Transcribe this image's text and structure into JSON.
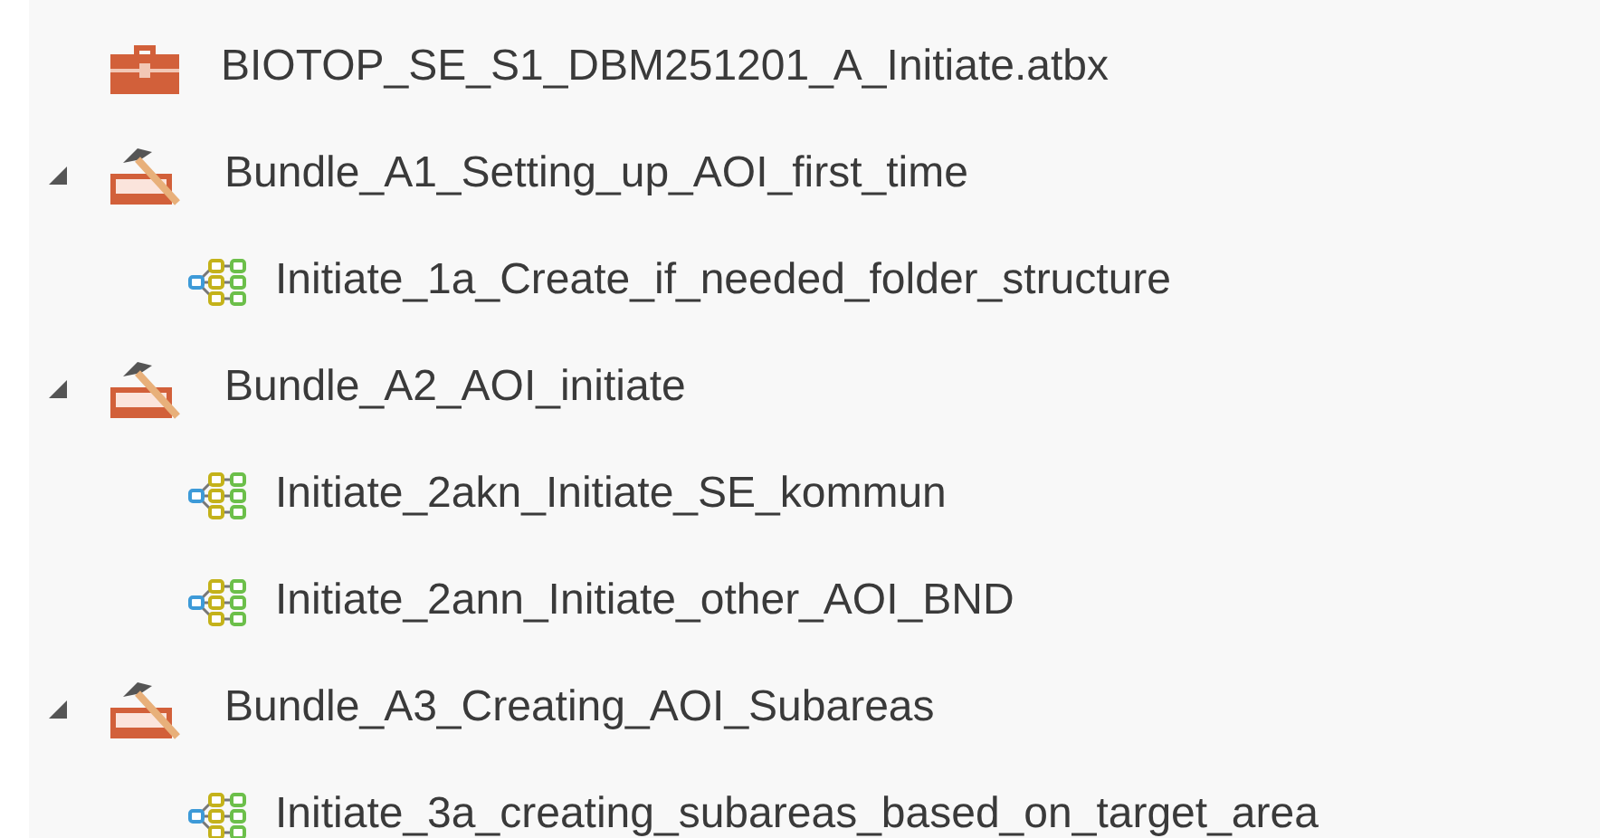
{
  "tree": {
    "kind": "toolbox",
    "label": "BIOTOP_SE_S1_DBM251201_A_Initiate.atbx",
    "children": [
      {
        "kind": "toolset",
        "label": "Bundle_A1_Setting_up_AOI_first_time",
        "expanded": true,
        "children": [
          {
            "kind": "model",
            "label": "Initiate_1a_Create_if_needed_folder_structure"
          }
        ]
      },
      {
        "kind": "toolset",
        "label": "Bundle_A2_AOI_initiate",
        "expanded": true,
        "children": [
          {
            "kind": "model",
            "label": "Initiate_2akn_Initiate_SE_kommun"
          },
          {
            "kind": "model",
            "label": "Initiate_2ann_Initiate_other_AOI_BND"
          }
        ]
      },
      {
        "kind": "toolset",
        "label": "Bundle_A3_Creating_AOI_Subareas",
        "expanded": true,
        "children": [
          {
            "kind": "model",
            "label": "Initiate_3a_creating_subareas_based_on_target_area"
          }
        ]
      }
    ]
  }
}
